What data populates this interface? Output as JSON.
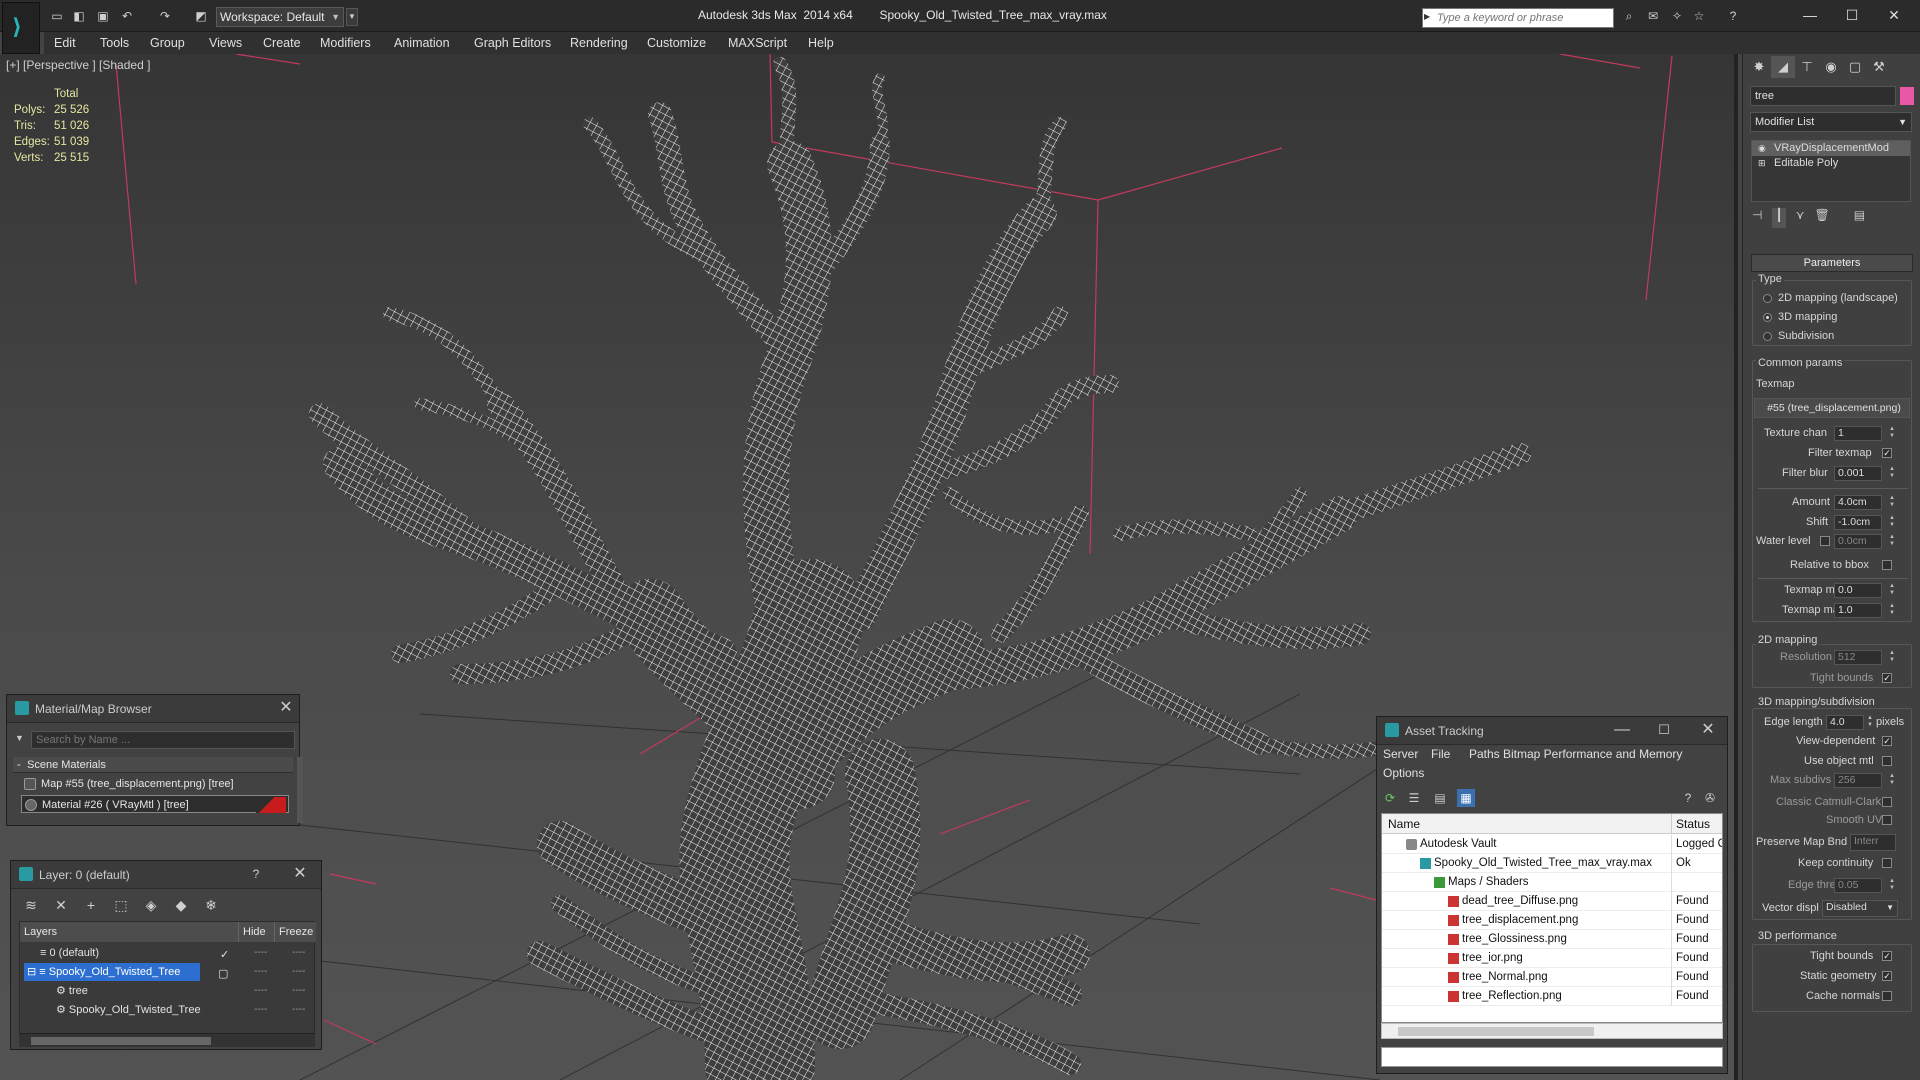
{
  "titlebar": {
    "workspace": "Workspace: Default",
    "app_title": "Autodesk 3ds Max  2014 x64",
    "file_title": "Spooky_Old_Twisted_Tree_max_vray.max",
    "search_placeholder": "Type a keyword or phrase"
  },
  "menu": [
    "Edit",
    "Tools",
    "Group",
    "Views",
    "Create",
    "Modifiers",
    "Animation",
    "Graph Editors",
    "Rendering",
    "Customize",
    "MAXScript",
    "Help"
  ],
  "viewport": {
    "label": "[+] [Perspective ] [Shaded ]",
    "stats": {
      "total_label": "Total",
      "rows": [
        {
          "k": "Polys:",
          "v": "25 526"
        },
        {
          "k": "Tris:",
          "v": "51 026"
        },
        {
          "k": "Edges:",
          "v": "51 039"
        },
        {
          "k": "Verts:",
          "v": "25 515"
        }
      ]
    }
  },
  "command_panel": {
    "object_name": "tree",
    "object_color": "#e85aa8",
    "modifier_list": "Modifier List",
    "stack": [
      "VRayDisplacementMod",
      "Editable Poly"
    ],
    "rollout_title": "Parameters",
    "type_label": "Type",
    "type_options": [
      "2D mapping (landscape)",
      "3D mapping",
      "Subdivision"
    ],
    "type_selected": 1,
    "common_params": "Common params",
    "texmap_label": "Texmap",
    "texmap_value": "#55 (tree_displacement.png)",
    "texture_chan_label": "Texture chan",
    "texture_chan": "1",
    "filter_texmap_label": "Filter texmap",
    "filter_blur_label": "Filter blur",
    "filter_blur": "0.001",
    "amount_label": "Amount",
    "amount": "4.0cm",
    "shift_label": "Shift",
    "shift": "-1.0cm",
    "water_level_label": "Water level",
    "water_level": "0.0cm",
    "relative_bbox_label": "Relative to bbox",
    "texmap_min_label": "Texmap min",
    "texmap_min": "0.0",
    "texmap_max_label": "Texmap max",
    "texmap_max": "1.0",
    "mapping2d_label": "2D mapping",
    "resolution_label": "Resolution",
    "resolution": "512",
    "tight_bounds_label": "Tight bounds",
    "subdiv_label": "3D mapping/subdivision",
    "edge_length_label": "Edge length",
    "edge_length": "4.0",
    "pixels_label": "pixels",
    "view_dependent_label": "View-dependent",
    "use_object_mtl_label": "Use object mtl",
    "max_subdivs_label": "Max subdivs",
    "max_subdivs": "256",
    "classic_cc_label": "Classic Catmull-Clark",
    "smooth_uvs_label": "Smooth UVs",
    "preserve_map_label": "Preserve Map Bnd",
    "preserve_map": "Interr",
    "keep_continuity_label": "Keep continuity",
    "edge_thresh_label": "Edge thresh",
    "edge_thresh": "0.05",
    "vector_displ_label": "Vector displ",
    "vector_displ": "Disabled",
    "perf_label": "3D performance",
    "perf_tight_bounds_label": "Tight bounds",
    "static_geometry_label": "Static geometry",
    "cache_normals_label": "Cache normals"
  },
  "material_browser": {
    "title": "Material/Map Browser",
    "search_placeholder": "Search by Name ...",
    "group": "Scene Materials",
    "items": [
      "Map #55 (tree_displacement.png)  [tree]",
      "Material #26  ( VRayMtl )  [tree]"
    ]
  },
  "layer_window": {
    "title": "Layer: 0 (default)",
    "help": "?",
    "col_layers": "Layers",
    "col_hide": "Hide",
    "col_freeze": "Freeze",
    "rows": [
      "0 (default)",
      "Spooky_Old_Twisted_Tree",
      "tree",
      "Spooky_Old_Twisted_Tree"
    ],
    "dash": "----"
  },
  "asset_tracking": {
    "title": "Asset Tracking",
    "menu": [
      "Server",
      "File",
      "Paths",
      "Bitmap Performance and Memory",
      "Options"
    ],
    "col_name": "Name",
    "col_status": "Status",
    "rows": [
      {
        "name": "Autodesk Vault",
        "status": "Logged Ou"
      },
      {
        "name": "Spooky_Old_Twisted_Tree_max_vray.max",
        "status": "Ok"
      },
      {
        "name": "Maps / Shaders",
        "status": ""
      },
      {
        "name": "dead_tree_Diffuse.png",
        "status": "Found"
      },
      {
        "name": "tree_displacement.png",
        "status": "Found"
      },
      {
        "name": "tree_Glossiness.png",
        "status": "Found"
      },
      {
        "name": "tree_ior.png",
        "status": "Found"
      },
      {
        "name": "tree_Normal.png",
        "status": "Found"
      },
      {
        "name": "tree_Reflection.png",
        "status": "Found"
      }
    ]
  }
}
